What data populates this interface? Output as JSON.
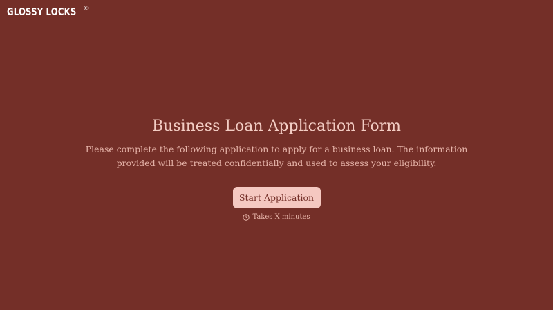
{
  "brand": {
    "name": "GLOSSY LOCKS",
    "mark": "©"
  },
  "hero": {
    "title": "Business Loan Application Form",
    "description": "Please complete the following application to apply for a business loan. The information provided will be treated confidentially and used to assess your eligibility.",
    "start_button_label": "Start Application",
    "timing_text": "Takes X minutes",
    "timing_icon": "clock-icon"
  },
  "colors": {
    "background": "#742f28",
    "title_text": "#f3cdc4",
    "body_text": "#e7b5aa",
    "button_background": "#f5c8c1",
    "button_text": "#742f28"
  }
}
